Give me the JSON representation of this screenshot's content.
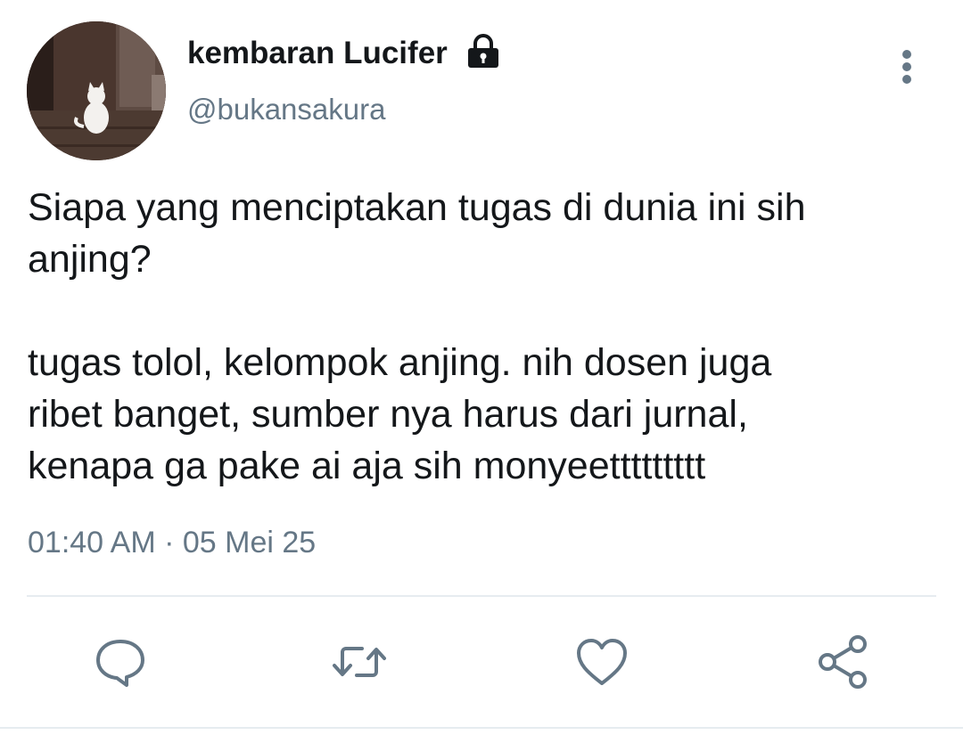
{
  "author": {
    "display_name": "kembaran Lucifer",
    "handle": "@bukansakura",
    "protected_icon": "lock-icon"
  },
  "tweet": {
    "line1": "Siapa yang menciptakan tugas di dunia ini sih",
    "line2": "anjing?",
    "line3": "tugas tolol, kelompok anjing. nih dosen juga",
    "line4": "ribet banget, sumber nya harus dari jurnal,",
    "line5": "kenapa ga pake ai aja sih monyeettttttttt",
    "timestamp": "01:40 AM · 05 Mei 25"
  },
  "actions": [
    "reply-icon",
    "retweet-icon",
    "like-icon",
    "share-icon"
  ],
  "colors": {
    "primary_text": "#14171a",
    "secondary_text": "#657786",
    "icon": "#657786",
    "divider": "#e6ecf0"
  }
}
